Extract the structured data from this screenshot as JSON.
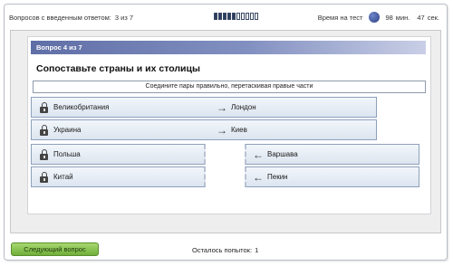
{
  "status": {
    "answered_label": "Вопросов с введенным ответом:",
    "answered_value": "3 из 7",
    "progress": [
      true,
      true,
      true,
      true,
      true,
      false,
      false,
      false,
      false,
      false
    ],
    "time_label": "Время на тест",
    "minutes": "98",
    "minutes_unit": "мин.",
    "seconds": "47",
    "seconds_unit": "сек."
  },
  "question": {
    "header": "Вопрос 4 из 7",
    "title": "Сопоставьте страны и их столицы",
    "instruction": "Соедините пары правильно, перетаскивая правые части"
  },
  "pairs_connected": [
    {
      "left": "Великобритания",
      "right": "Лондон"
    },
    {
      "left": "Украина",
      "right": "Киев"
    }
  ],
  "left_items": [
    "Польша",
    "Китай"
  ],
  "right_items": [
    "Варшава",
    "Пекин"
  ],
  "icons": {
    "lock": "lock-icon",
    "arrow_right": "arrow-right-icon",
    "arrow_left": "arrow-left-icon",
    "clock": "clock-icon"
  },
  "footer": {
    "next_button": "Следующий вопрос",
    "attempts_label": "Осталось попыток:",
    "attempts_value": "1"
  }
}
